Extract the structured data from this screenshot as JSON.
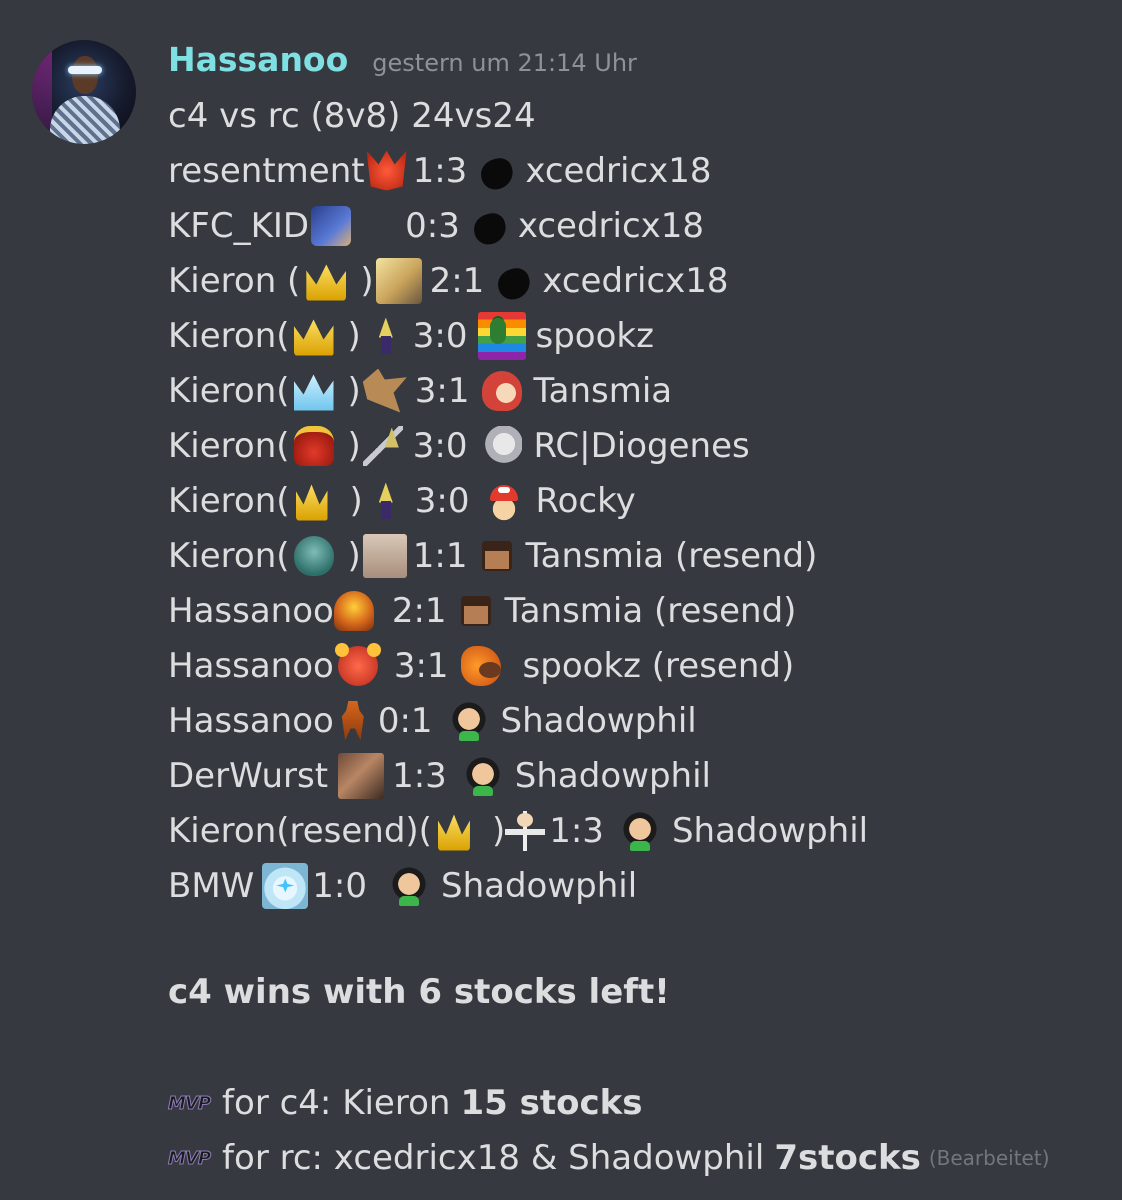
{
  "message": {
    "username": "Hassanoo",
    "timestamp": "gestern um 21:14 Uhr",
    "title": "c4 vs rc (8v8) 24vs24",
    "rows": [
      {
        "left": "resentment",
        "left_icon": "red-mask-icon",
        "score": "1:3",
        "right_icon": "black-blob-icon",
        "right": "xcedricx18"
      },
      {
        "left": "KFC_KID",
        "left_icon": "anime-character-icon",
        "score": "0:3",
        "right_icon": "black-blob-icon",
        "right": "xcedricx18"
      },
      {
        "left": "Kieron (",
        "crown_icon": "gold-crown-icon",
        "left_suffix": ")",
        "left_icon": "cloud-portrait-icon",
        "score": "2:1",
        "right_icon": "black-blob-icon",
        "right": "xcedricx18"
      },
      {
        "left": "Kieron(",
        "crown_icon": "gold-crown-icon",
        "left_suffix": ")",
        "left_icon": "cloud-chibi-icon",
        "score": "3:0",
        "right_icon": "rainbow-luigi-icon",
        "right": "spookz"
      },
      {
        "left": "Kieron(",
        "crown_icon": "blue-crown-icon",
        "left_suffix": ")",
        "left_icon": "cloud-spiky-icon",
        "score": "3:1",
        "right_icon": "red-hair-character-icon",
        "right": "Tansmia"
      },
      {
        "left": "Kieron(",
        "crown_icon": "red-crown-icon",
        "left_suffix": ")",
        "left_icon": "cloud-sword-icon",
        "score": "3:0",
        "right_icon": "sephiroth-icon",
        "right": "RC|Diogenes"
      },
      {
        "left": "Kieron(",
        "crown_icon": "gold-crown-icon",
        "left_suffix": ")",
        "left_icon": "cloud-standing-icon",
        "score": "3:0",
        "right_icon": "red-cap-character-icon",
        "right": "Rocky"
      },
      {
        "left": "Kieron(",
        "crown_icon": "teal-spirit-icon",
        "left_suffix": ")",
        "left_icon": "pale-face-icon",
        "score": "1:1",
        "right_icon": "steve-icon",
        "right": "Tansmia (resend)"
      },
      {
        "left": "Hassanoo",
        "left_icon": "samus-helmet-icon",
        "score": "2:1",
        "right_icon": "steve-icon",
        "right": "Tansmia (resend)"
      },
      {
        "left": "Hassanoo",
        "left_icon": "banjo-icon",
        "score": "3:1",
        "right_icon": "kazooie-icon",
        "right": "spookz (resend)"
      },
      {
        "left": "Hassanoo",
        "left_icon": "samus-full-icon",
        "score": "0:1",
        "right_icon": "little-mac-icon",
        "right": "Shadowphil"
      },
      {
        "left": "DerWurst",
        "left_icon": "photo-icon",
        "score": "1:3",
        "right_icon": "little-mac-icon",
        "right": "Shadowphil"
      },
      {
        "left": "Kieron(resend)(",
        "crown_icon": "gold-crown-icon",
        "left_suffix": ")",
        "left_icon": "dr-mario-icon",
        "score": "1:3",
        "right_icon": "little-mac-icon",
        "right": "Shadowphil"
      },
      {
        "left": "BMW",
        "left_icon": "anime-white-hair-icon",
        "score": "1:0",
        "right_icon": "little-mac-icon",
        "right": "Shadowphil"
      }
    ],
    "result": "c4 wins with 6 stocks left!",
    "mvp1": {
      "badge": "MVP",
      "text": "for c4: Kieron",
      "bold": "15 stocks"
    },
    "mvp2": {
      "badge": "MVP",
      "text": "for rc: xcedricx18 & Shadowphil",
      "bold": "7stocks",
      "edited": "(Bearbeitet)"
    }
  }
}
